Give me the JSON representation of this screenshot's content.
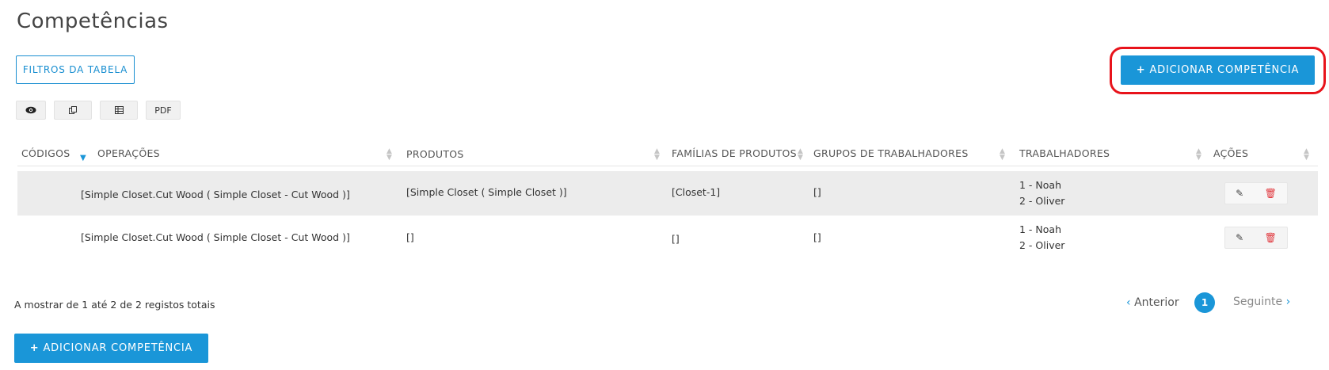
{
  "page": {
    "title": "Competências"
  },
  "toolbar": {
    "filters_label": "FILTROS DA TABELA",
    "add_label": "ADICIONAR COMPETÊNCIA",
    "add_plus": "+",
    "export": {
      "pdf_label": "PDF"
    }
  },
  "icons": {
    "view": "eye-icon",
    "copy": "copy-icon",
    "csv": "table-icon",
    "edit": "edit-icon",
    "delete": "trash-icon"
  },
  "colors": {
    "accent": "#1a96d8",
    "highlight": "#e8131b",
    "danger": "#e0343a"
  },
  "table": {
    "headers": {
      "codes": "CÓDIGOS",
      "operations": "OPERAÇÕES",
      "products": "PRODUTOS",
      "families": "FAMÍLIAS DE PRODUTOS",
      "groups": "GRUPOS DE TRABALHADORES",
      "workers": "TRABALHADORES",
      "actions": "AÇÕES"
    },
    "rows": [
      {
        "code": "",
        "operations": "[Simple Closet.Cut Wood ( Simple Closet - Cut Wood )]",
        "products": "[Simple Closet ( Simple Closet )]",
        "families": "[Closet-1]",
        "groups": "[]",
        "workers": [
          "1 - Noah",
          "2 - Oliver"
        ]
      },
      {
        "code": "",
        "operations": "[Simple Closet.Cut Wood ( Simple Closet - Cut Wood )]",
        "products": "[]",
        "families": "[]",
        "groups": "[]",
        "workers": [
          "1 - Noah",
          "2 - Oliver"
        ]
      }
    ]
  },
  "footer": {
    "summary": "A mostrar de 1 até 2 de 2 registos totais",
    "prev_label": "Anterior",
    "next_label": "Seguinte",
    "current_page": "1"
  }
}
